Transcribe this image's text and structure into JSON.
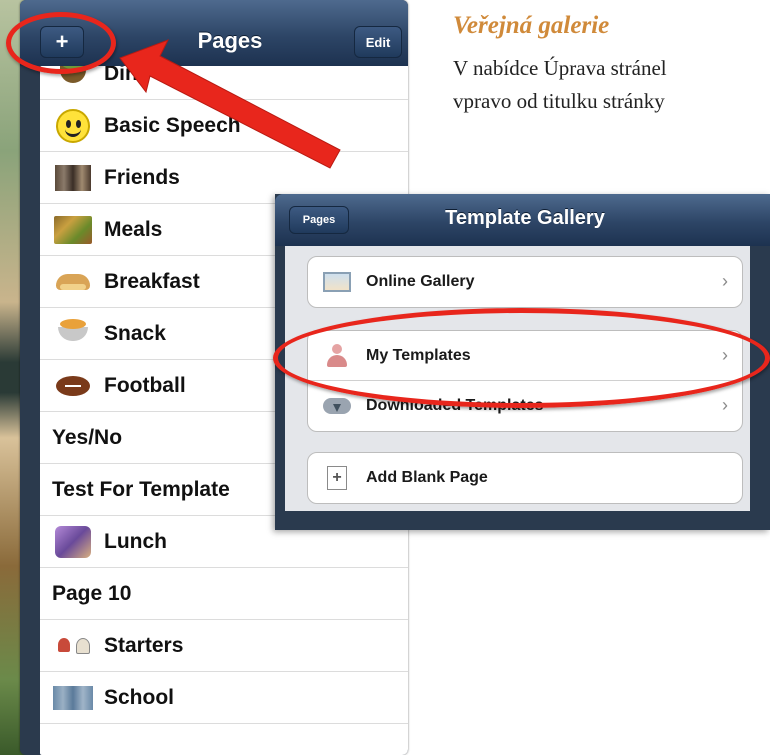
{
  "pages_panel": {
    "title": "Pages",
    "add_label": "+",
    "edit_label": "Edit",
    "items": [
      {
        "label": "Dinn",
        "icon": "bowl-icon"
      },
      {
        "label": "Basic Speech",
        "icon": "smiley-icon"
      },
      {
        "label": "Friends",
        "icon": "photo-icon"
      },
      {
        "label": "Meals",
        "icon": "meal-icon"
      },
      {
        "label": "Breakfast",
        "icon": "bread-icon"
      },
      {
        "label": "Snack",
        "icon": "snack-icon"
      },
      {
        "label": "Football",
        "icon": "football-icon"
      },
      {
        "label": "Yes/No",
        "icon": ""
      },
      {
        "label": "Test For Template",
        "icon": ""
      },
      {
        "label": "Lunch",
        "icon": "lunch-icon"
      },
      {
        "label": "Page 10",
        "icon": ""
      },
      {
        "label": "Starters",
        "icon": "starters-icon"
      },
      {
        "label": "School",
        "icon": "school-icon"
      }
    ]
  },
  "article": {
    "heading": "Veřejná galerie",
    "lines": [
      "V nabídce Úprava stránel",
      "vpravo od titulku stránky"
    ]
  },
  "template_gallery": {
    "title": "Template Gallery",
    "back_label": "Pages",
    "group1": [
      {
        "label": "Online Gallery",
        "icon": "frame-icon",
        "chevron": "›"
      }
    ],
    "group2": [
      {
        "label": "My Templates",
        "icon": "person-icon",
        "chevron": "›"
      },
      {
        "label": "Downloaded Templates",
        "icon": "download-icon",
        "chevron": "›"
      }
    ],
    "group3": [
      {
        "label": "Add Blank Page",
        "icon": "blank-page-icon"
      }
    ]
  },
  "colors": {
    "annotation": "#e8261c",
    "heading": "#d08a3a",
    "navbar": "#2d4566"
  }
}
